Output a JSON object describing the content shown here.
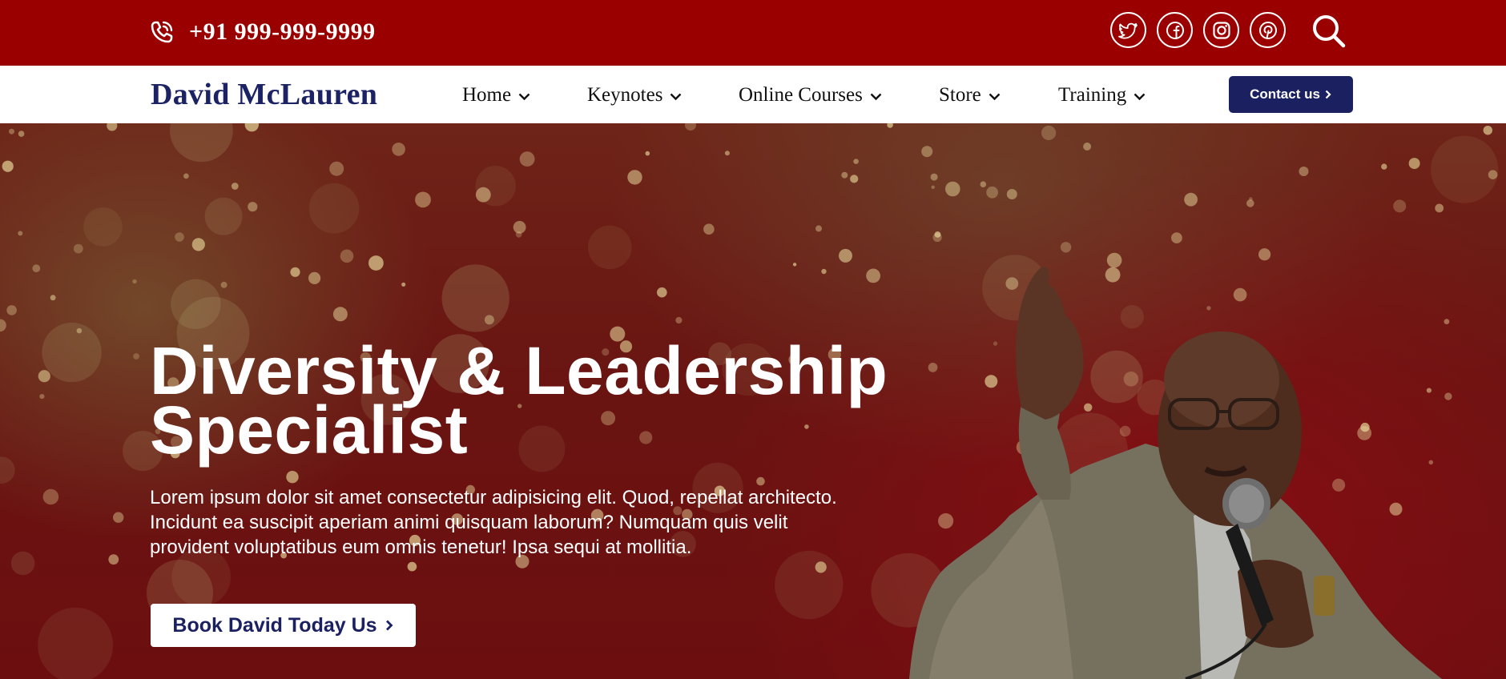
{
  "topbar": {
    "phone_icon": "phone-ringing-icon",
    "phone": "+91 999-999-9999",
    "socials": [
      {
        "name": "twitter-icon"
      },
      {
        "name": "facebook-icon"
      },
      {
        "name": "instagram-icon"
      },
      {
        "name": "pinterest-icon"
      }
    ],
    "search_icon": "search-icon"
  },
  "nav": {
    "brand": "David McLauren",
    "items": [
      {
        "label": "Home"
      },
      {
        "label": "Keynotes"
      },
      {
        "label": "Online Courses"
      },
      {
        "label": "Store"
      },
      {
        "label": "Training"
      }
    ],
    "dropdown_icon": "chevron-down-icon",
    "contact_label": "Contact us"
  },
  "hero": {
    "title_line1": "Diversity & Leadership",
    "title_line2": "Specialist",
    "body": "Lorem ipsum dolor sit amet consectetur adipisicing elit. Quod, repellat architecto. Incidunt ea suscipit aperiam animi quisquam laborum? Numquam quis velit provident voluptatibus eum omnis tenetur! Ipsa sequi at mollitia.",
    "cta_label": "Book David Today Us"
  },
  "colors": {
    "topbar_bg": "#9a0000",
    "brand_navy": "#1b2061",
    "hero_red": "#6c0e10",
    "white": "#ffffff"
  }
}
